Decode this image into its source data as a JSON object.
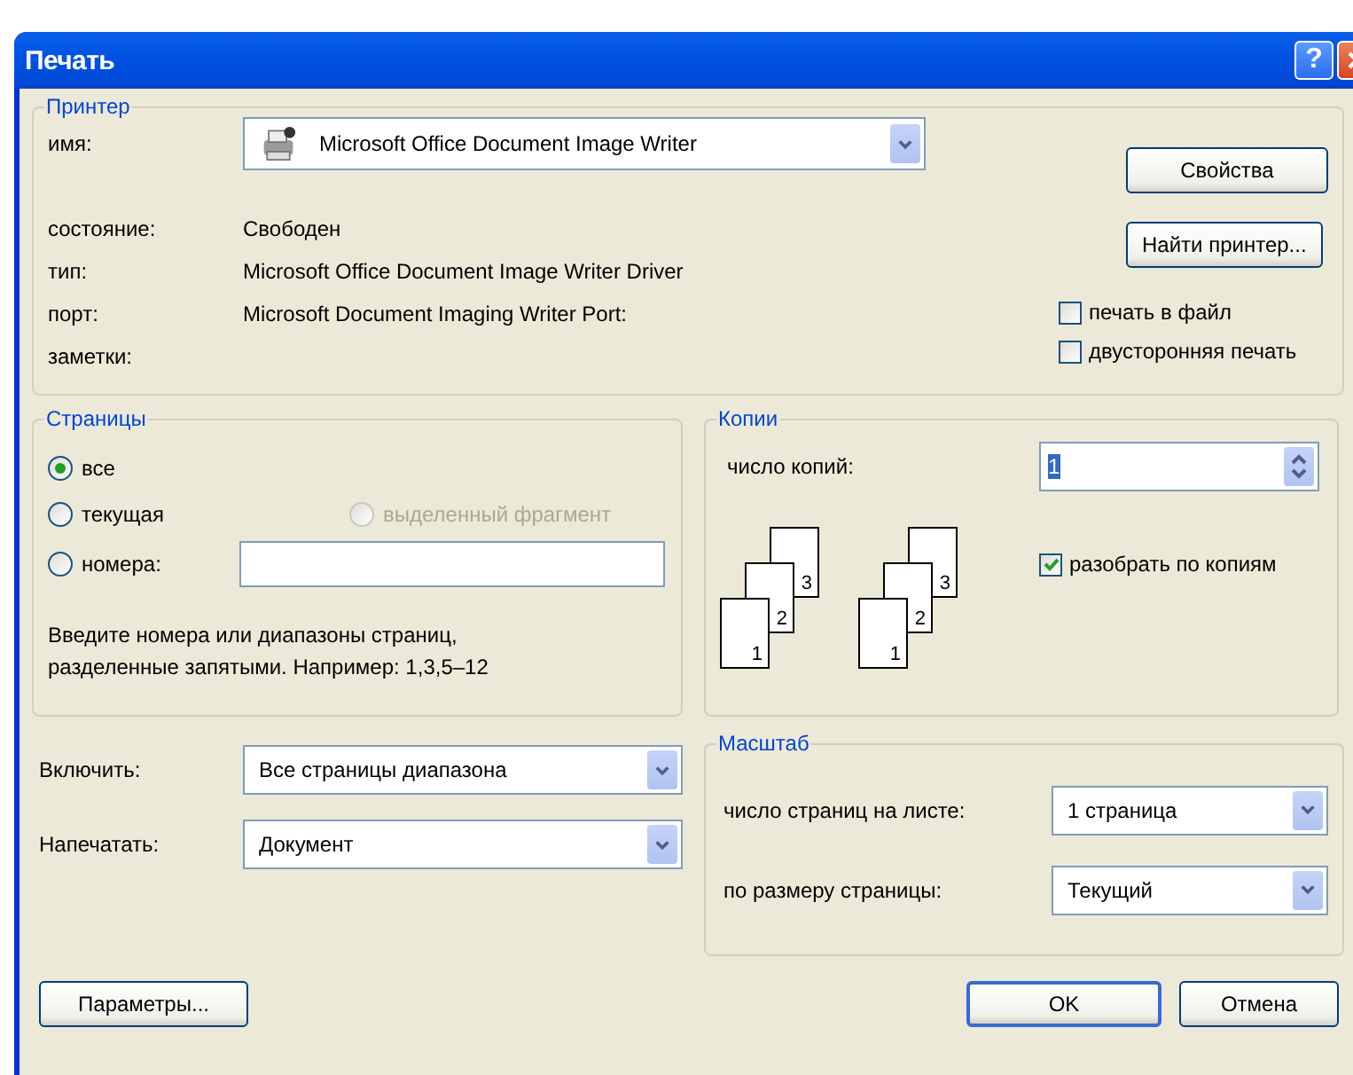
{
  "window": {
    "title": "Печать",
    "help": "?"
  },
  "printer": {
    "legend": "Принтер",
    "name_label": "имя:",
    "name_value": "Microsoft Office Document Image Writer",
    "fields": [
      {
        "label": "состояние:",
        "value": "Свободен"
      },
      {
        "label": "тип:",
        "value": "Microsoft Office Document Image Writer Driver"
      },
      {
        "label": "порт:",
        "value": "Microsoft Document Imaging Writer Port:"
      },
      {
        "label": "заметки:"
      }
    ],
    "buttons": [
      "Свойства",
      "Найти принтер..."
    ],
    "options": [
      {
        "label": "печать в файл",
        "checked": false
      },
      {
        "label": "двусторонняя печать",
        "checked": false
      }
    ]
  },
  "pages": {
    "legend": "Страницы",
    "options": [
      {
        "label": "все",
        "selected": true,
        "disabled": false
      },
      {
        "label": "текущая",
        "selected": false,
        "disabled": false
      },
      {
        "label": "выделенный фрагмент",
        "selected": false,
        "disabled": true
      },
      {
        "label": "номера:",
        "selected": false,
        "disabled": false
      }
    ],
    "hint": "Введите номера или диапазоны страниц, разделенные запятыми. Например: 1,3,5–12"
  },
  "copies": {
    "legend": "Копии",
    "count_label": "число копий:",
    "count_value": "1",
    "count_selected": true,
    "stacks": [
      [
        "1",
        "2",
        "3"
      ],
      [
        "1",
        "2",
        "3"
      ]
    ],
    "collate": {
      "label": "разобрать по копиям",
      "checked": true
    }
  },
  "include": {
    "label": "Включить:",
    "value": "Все страницы диапазона"
  },
  "print_what": {
    "label": "Напечатать:",
    "value": "Документ"
  },
  "scale": {
    "legend": "Масштаб",
    "rows": [
      {
        "label": "число страниц на листе:",
        "value": "1 страница"
      },
      {
        "label": "по размеру страницы:",
        "value": "Текущий"
      }
    ]
  },
  "footer": {
    "options_button": "Параметры...",
    "ok": "OK",
    "cancel": "Отмена"
  }
}
